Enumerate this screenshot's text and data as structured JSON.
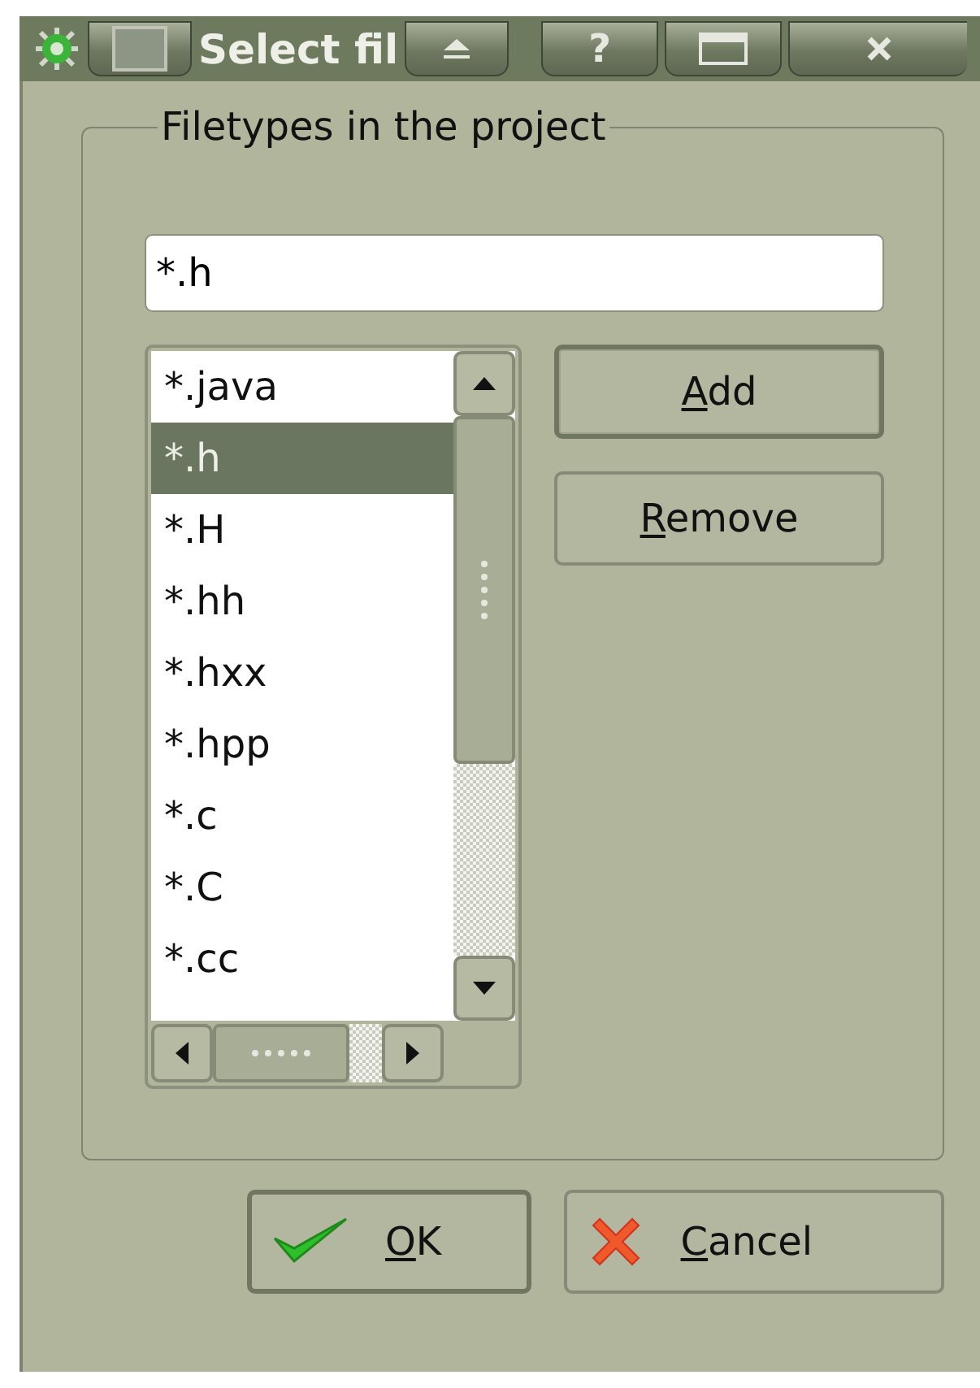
{
  "window": {
    "title": "Select fil",
    "help_button": "?"
  },
  "group": {
    "title": "Filetypes in the project"
  },
  "pattern_field": {
    "value": "*.h"
  },
  "filetypes": [
    {
      "label": "*.java",
      "selected": false
    },
    {
      "label": "*.h",
      "selected": true
    },
    {
      "label": "*.H",
      "selected": false
    },
    {
      "label": "*.hh",
      "selected": false
    },
    {
      "label": "*.hxx",
      "selected": false
    },
    {
      "label": "*.hpp",
      "selected": false
    },
    {
      "label": "*.c",
      "selected": false
    },
    {
      "label": "*.C",
      "selected": false
    },
    {
      "label": "*.cc",
      "selected": false
    }
  ],
  "side_buttons": [
    {
      "mnemonic": "A",
      "rest": "dd",
      "default": true
    },
    {
      "mnemonic": "R",
      "rest": "emove",
      "default": false
    }
  ],
  "footer_buttons": [
    {
      "kind": "ok",
      "mnemonic": "O",
      "rest": "K",
      "default": true
    },
    {
      "kind": "cancel",
      "mnemonic": "C",
      "rest": "ancel",
      "default": false
    }
  ]
}
